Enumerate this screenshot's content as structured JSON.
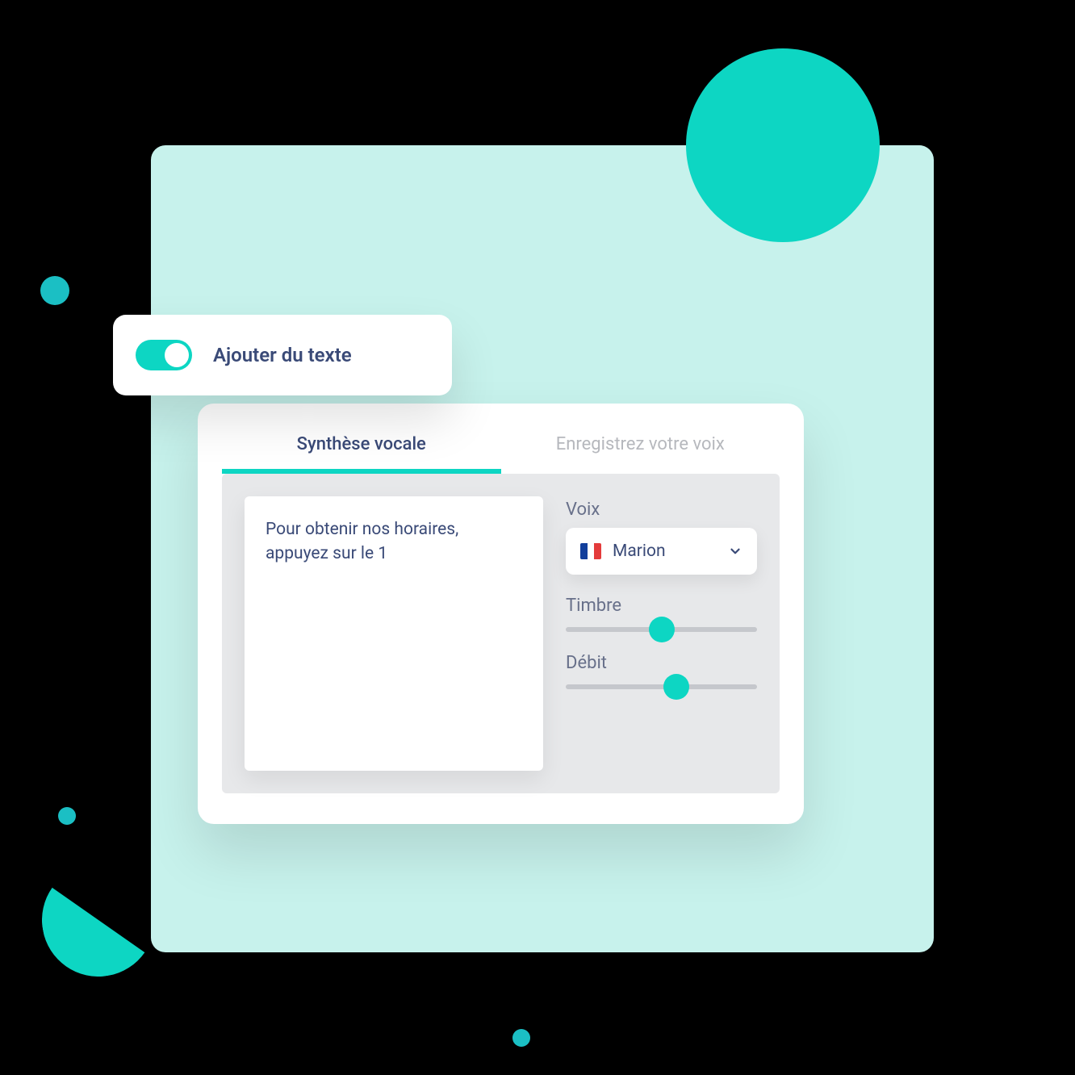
{
  "toggle": {
    "label": "Ajouter du texte",
    "state": "on"
  },
  "tabs": {
    "active": "Synthèse vocale",
    "inactive": "Enregistrez votre voix"
  },
  "textbox": {
    "content": "Pour obtenir nos horaires, appuyez sur le 1"
  },
  "voice": {
    "label": "Voix",
    "selected": "Marion",
    "flag": "france"
  },
  "timbre": {
    "label": "Timbre",
    "value_percent": 50
  },
  "debit": {
    "label": "Débit",
    "value_percent": 58
  },
  "colors": {
    "accent": "#0dd6c3",
    "text_primary": "#3a4a77",
    "text_muted": "#b6b8bd",
    "panel_bg": "#c7f2ec"
  }
}
